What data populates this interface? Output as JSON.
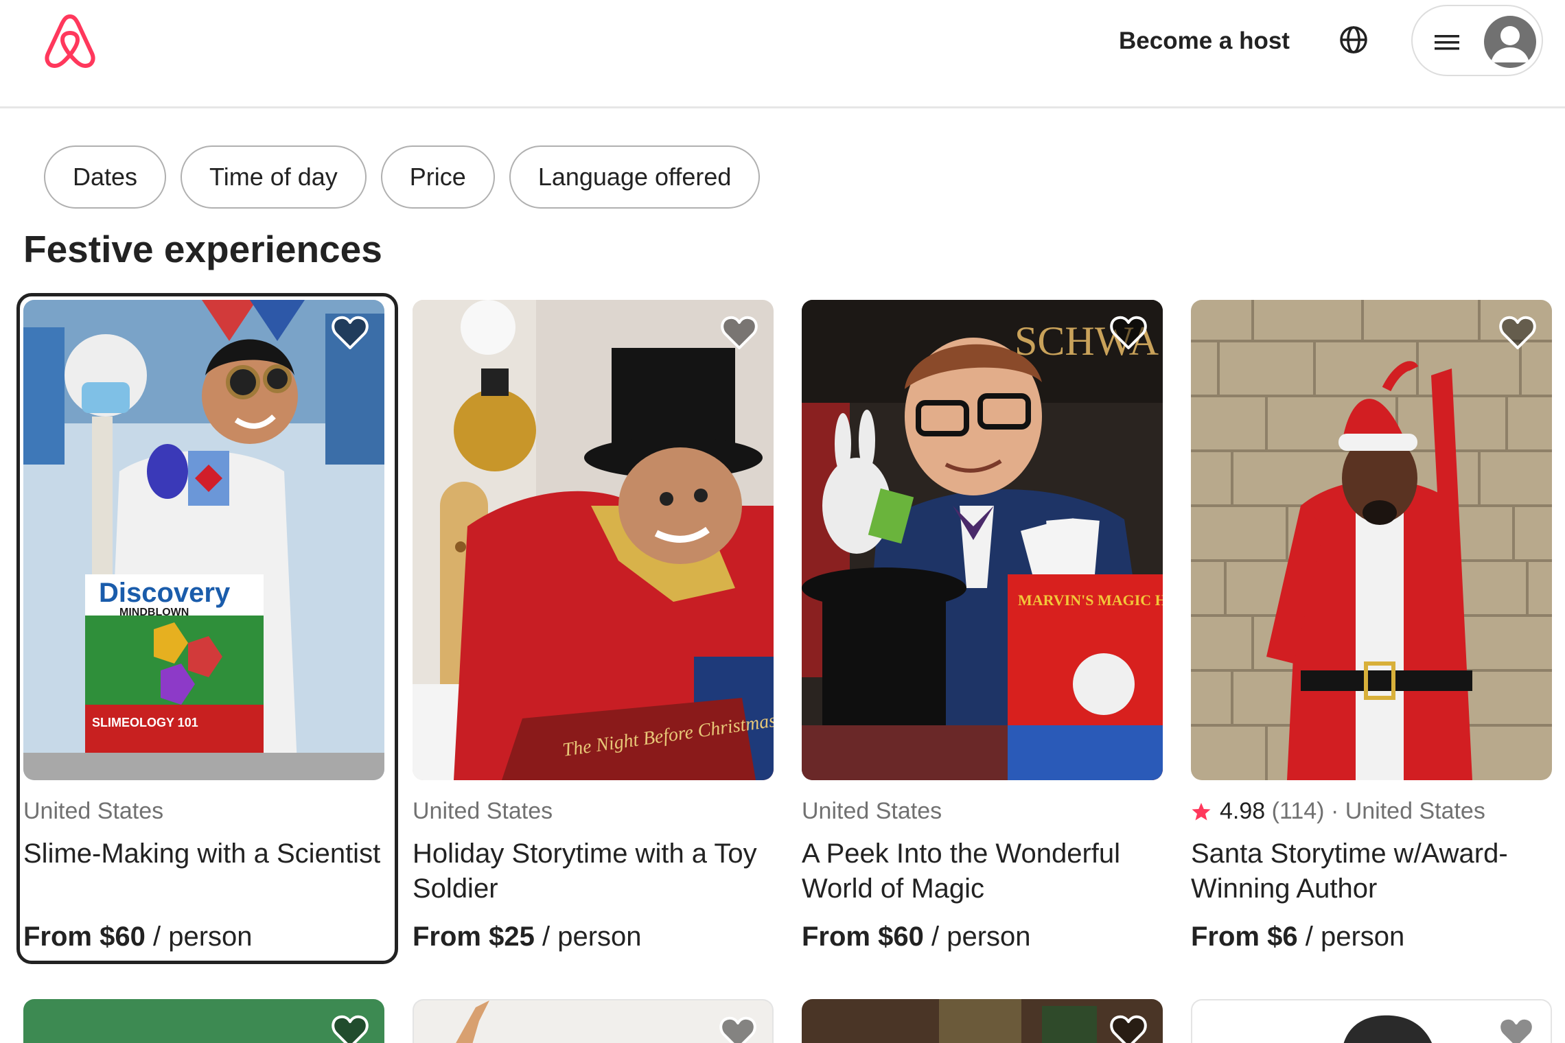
{
  "header": {
    "logo": "airbnb-logo",
    "become_host": "Become a host",
    "icons": [
      "globe-icon",
      "menu-icon",
      "avatar-icon"
    ]
  },
  "filters": [
    "Dates",
    "Time of day",
    "Price",
    "Language offered"
  ],
  "section": {
    "title": "Festive experiences"
  },
  "cards": [
    {
      "location": "United States",
      "rating": "",
      "reviews": "",
      "title": "Slime-Making with a Scientist",
      "price": "From $60",
      "per": "/ person"
    },
    {
      "location": "United States",
      "rating": "",
      "reviews": "",
      "title": "Holiday Storytime with a Toy Soldier",
      "price": "From $25",
      "per": "/ person"
    },
    {
      "location": "United States",
      "rating": "",
      "reviews": "",
      "title": "A Peek Into the Wonderful World of Magic",
      "price": "From $60",
      "per": "/ person"
    },
    {
      "location": "· United States",
      "rating": "4.98",
      "reviews": "(114)",
      "title": "Santa Storytime w/Award-Winning Author",
      "price": "From $6",
      "per": "/ person"
    }
  ],
  "image_text": {
    "card1_box_brand": "Discovery",
    "card1_box_sub": "MINDBLOWN",
    "card1_box_line": "SLIMEOLOGY 101",
    "card2_book": "The Night Before Christmas",
    "card3_box": "MARVIN'S MAGIC HAT",
    "card3_sign": "SCHWA"
  },
  "colors": {
    "brand": "#FF385C",
    "text_primary": "#222222",
    "text_secondary": "#717171",
    "border": "#B0B0B0"
  }
}
